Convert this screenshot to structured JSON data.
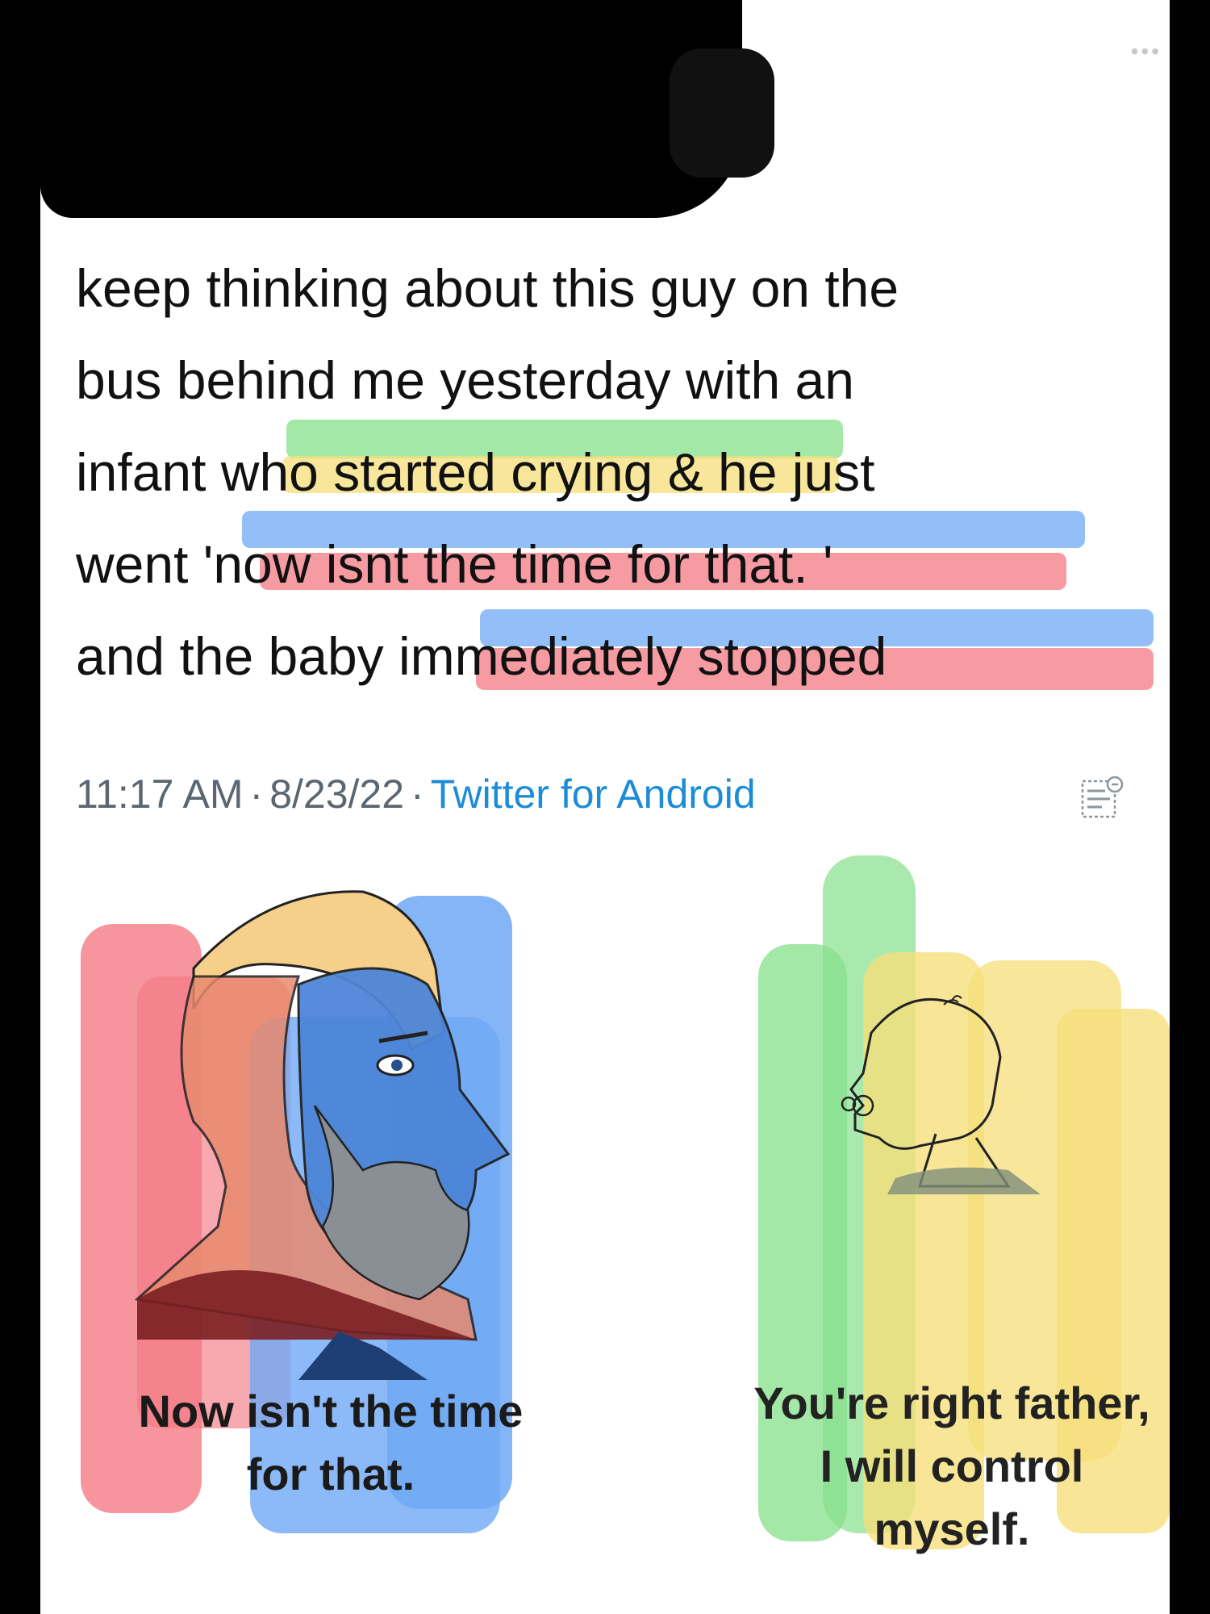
{
  "tweet": {
    "text_lines": [
      "keep thinking about this guy on the",
      "bus behind me yesterday with an",
      "infant who started crying & he just",
      "went 'now isnt the time for that. '",
      "and the baby immediately stopped"
    ],
    "time": "11:17 AM",
    "date": "8/23/22",
    "source": "Twitter for Android",
    "separator": "·"
  },
  "icons": {
    "more": "more-options-icon",
    "stats": "tweet-analytics-icon"
  },
  "meme": {
    "left_caption_line1": "Now isn't the time",
    "left_caption_line2": "for that.",
    "right_caption_line1": "You're right father,",
    "right_caption_line2": "I will control",
    "right_caption_line3": "myself."
  },
  "colors": {
    "highlight_green": "#86e08a",
    "highlight_yellow": "#f6df7a",
    "highlight_blue": "#6fa8f5",
    "highlight_red": "#f47a84",
    "link_blue": "#1d8cd8"
  }
}
